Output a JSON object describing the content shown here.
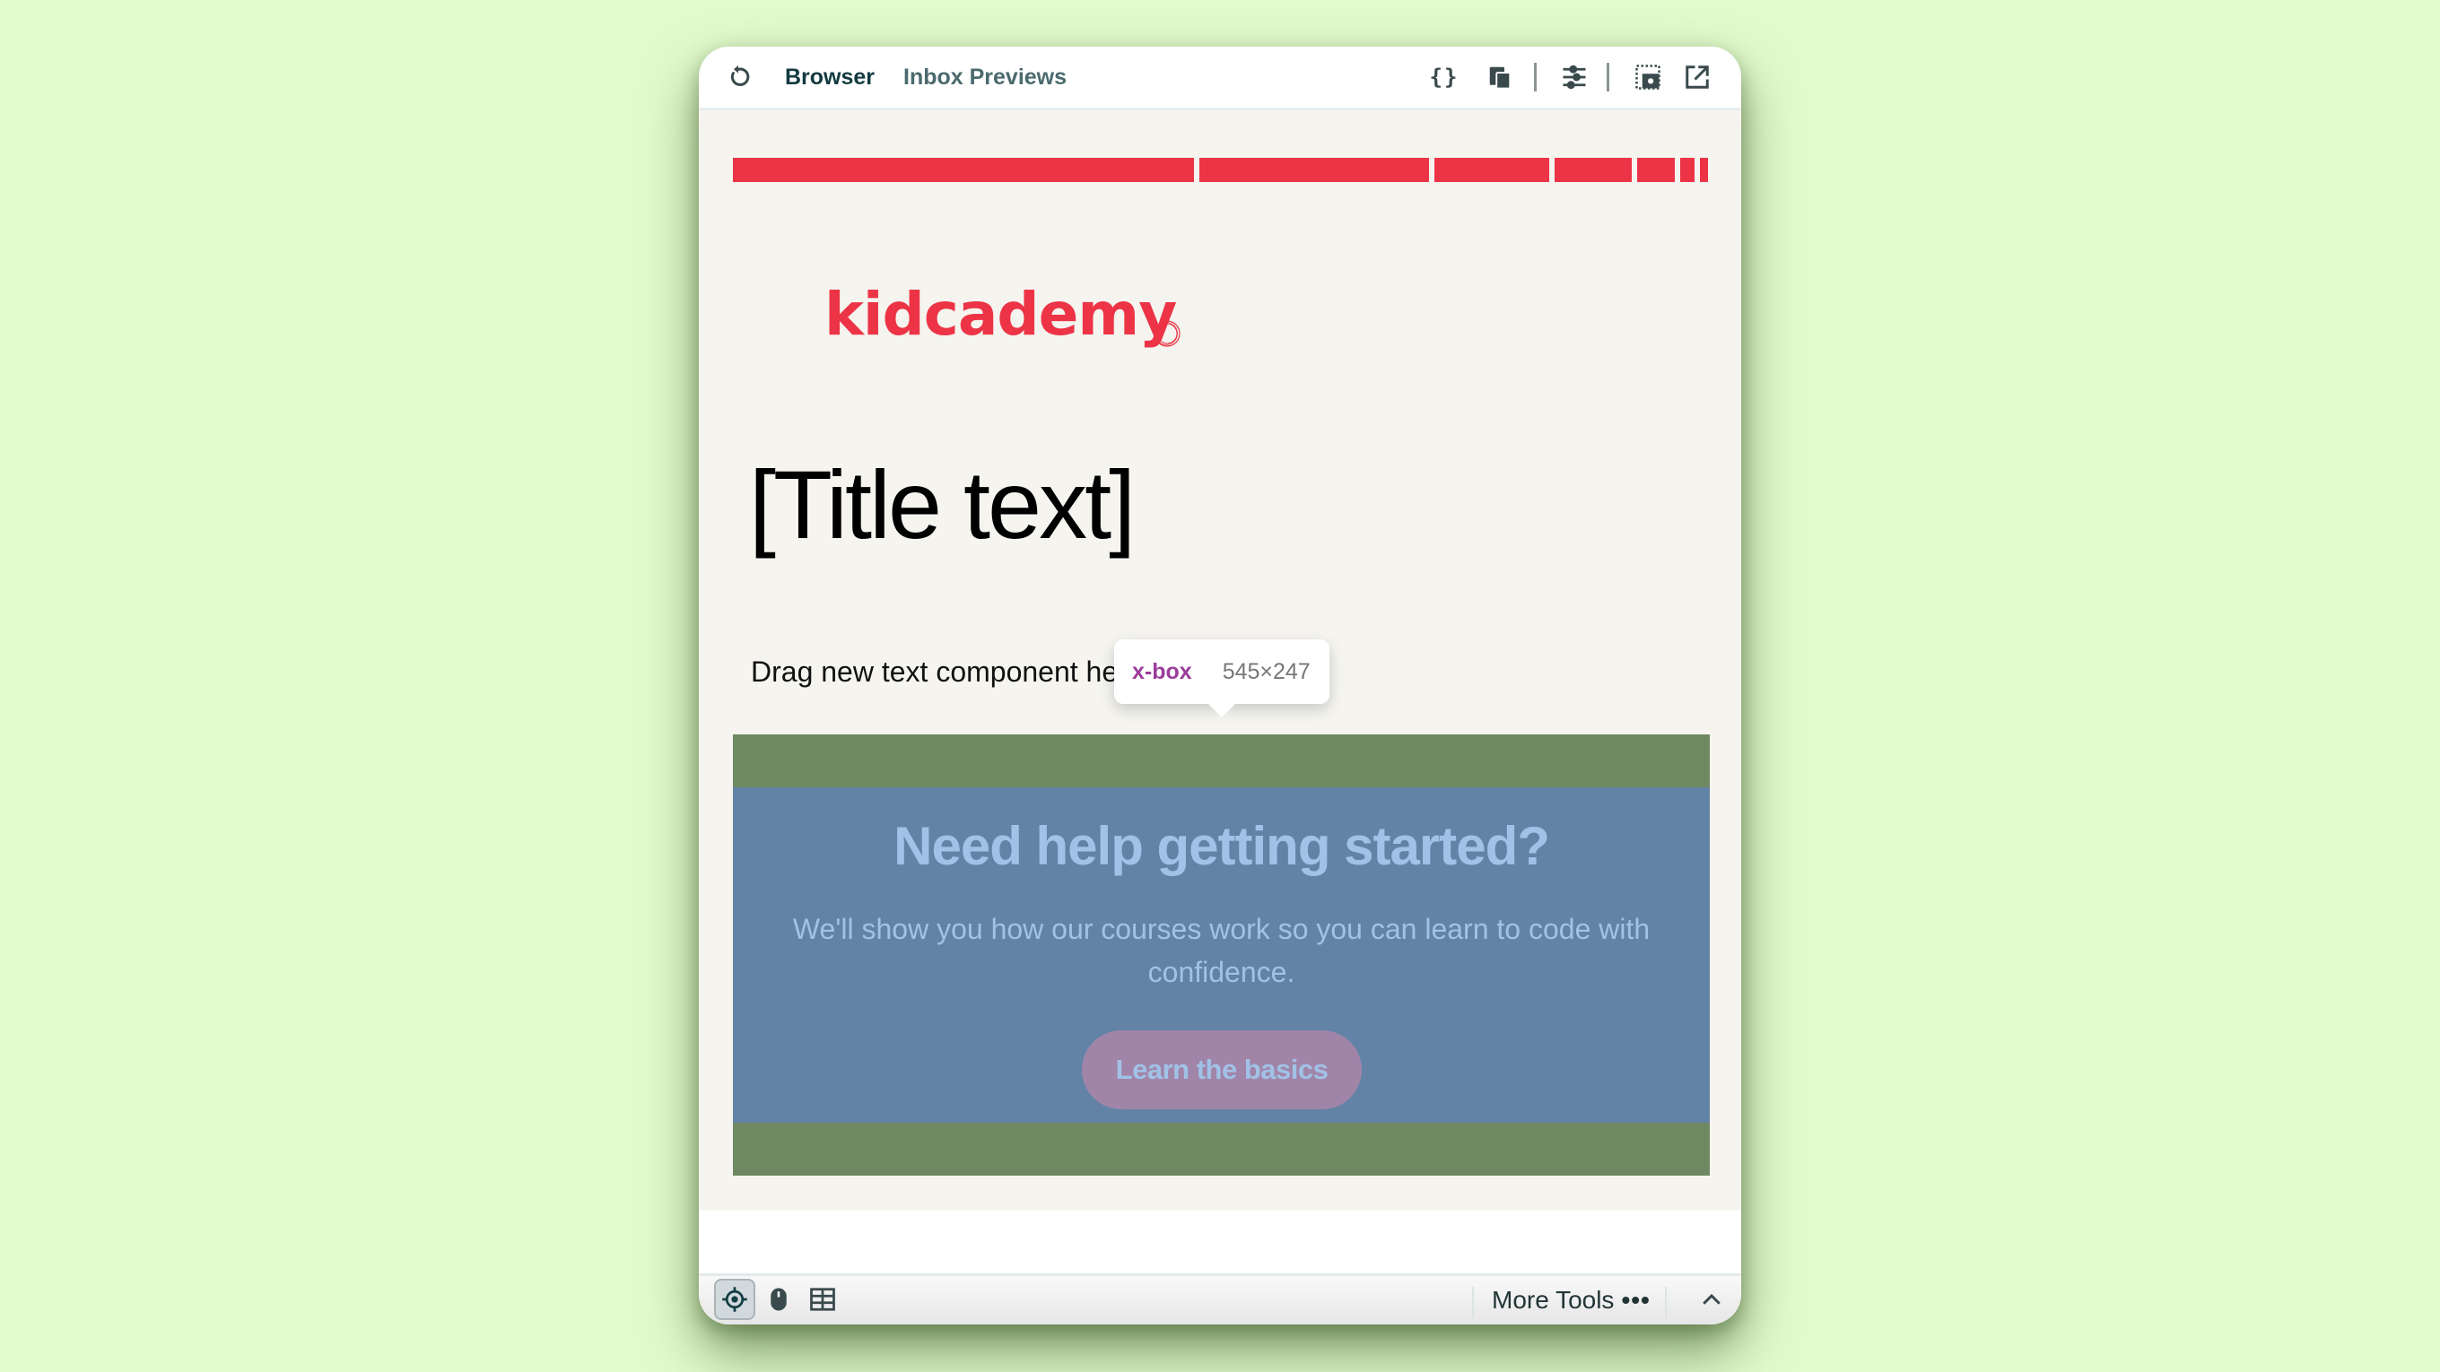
{
  "topbar": {
    "reload_icon": "reload-icon",
    "tabs": [
      {
        "label": "Browser",
        "active": true
      },
      {
        "label": "Inbox Previews",
        "active": false
      }
    ],
    "right_icons": [
      "code-braces-icon",
      "copy-devices-icon",
      "sliders-icon",
      "screenshot-icon",
      "open-external-icon"
    ]
  },
  "email": {
    "accent_color": "#ec3446",
    "logo_text": "kidcademy",
    "title": "[Title text]",
    "drag_text": "Drag new text component here for content",
    "cta": {
      "heading": "Need help getting started?",
      "body": "We'll show you how our courses work so you can learn to code with confidence.",
      "button_label": "Learn the basics"
    }
  },
  "inspector_tooltip": {
    "element_name": "x-box",
    "dimensions": "545×247"
  },
  "bottombar": {
    "tools": [
      "target-icon",
      "mouse-icon",
      "grid-icon"
    ],
    "more_tools_label": "More Tools",
    "more_tools_dots": "•••",
    "collapse_icon": "chevron-up-icon"
  }
}
